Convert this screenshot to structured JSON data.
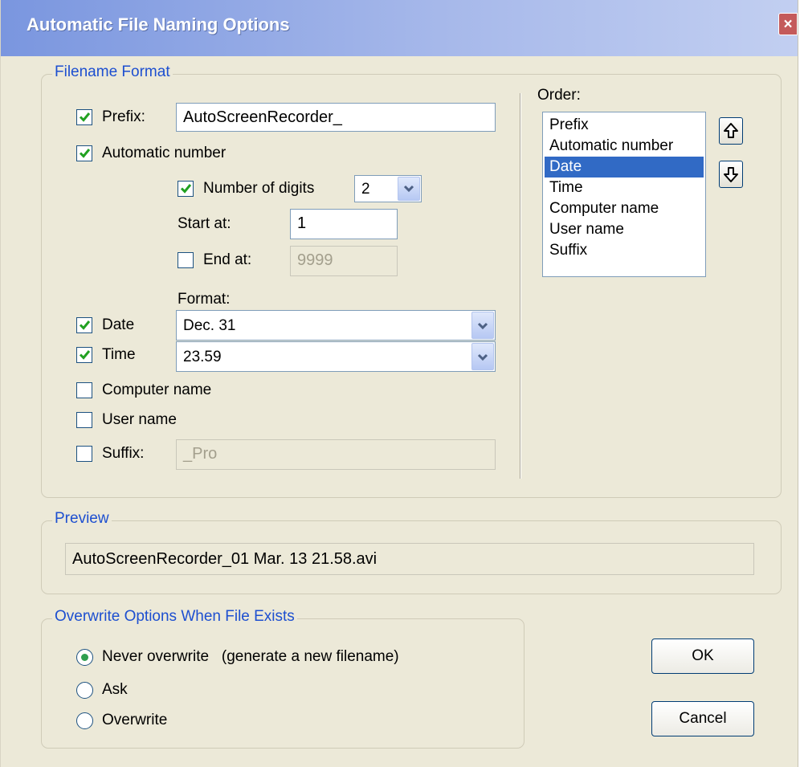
{
  "window": {
    "title": "Automatic File Naming Options",
    "close_label": "×"
  },
  "filename_format": {
    "legend": "Filename Format",
    "prefix": {
      "label": "Prefix:",
      "checked": true,
      "value": "AutoScreenRecorder_"
    },
    "automatic_number": {
      "label": "Automatic number",
      "checked": true,
      "number_of_digits": {
        "label": "Number of digits",
        "checked": true,
        "value": "2"
      },
      "start_at": {
        "label": "Start at:",
        "value": "1"
      },
      "end_at": {
        "label": "End at:",
        "checked": false,
        "value": "9999"
      }
    },
    "format_label": "Format:",
    "date": {
      "label": "Date",
      "checked": true,
      "value": "Dec. 31"
    },
    "time": {
      "label": "Time",
      "checked": true,
      "value": "23.59"
    },
    "computer_name": {
      "label": "Computer name",
      "checked": false
    },
    "user_name": {
      "label": "User name",
      "checked": false
    },
    "suffix": {
      "label": "Suffix:",
      "checked": false,
      "value": "_Pro"
    }
  },
  "order": {
    "label": "Order:",
    "items": [
      "Prefix",
      "Automatic number",
      "Date",
      "Time",
      "Computer name",
      "User name",
      "Suffix"
    ],
    "selected": "Date",
    "up_icon": "arrow-up-icon",
    "down_icon": "arrow-down-icon"
  },
  "preview": {
    "legend": "Preview",
    "value": "AutoScreenRecorder_01 Mar. 13 21.58.avi"
  },
  "overwrite": {
    "legend": "Overwrite Options When File Exists",
    "options": [
      {
        "label": "Never overwrite   (generate a new filename)",
        "selected": true
      },
      {
        "label": "Ask",
        "selected": false
      },
      {
        "label": "Overwrite",
        "selected": false
      }
    ]
  },
  "buttons": {
    "ok": "OK",
    "cancel": "Cancel"
  },
  "colors": {
    "legend": "#1d4fd0",
    "selection": "#316ac5",
    "face": "#ece9d8",
    "check": "#21a121"
  }
}
